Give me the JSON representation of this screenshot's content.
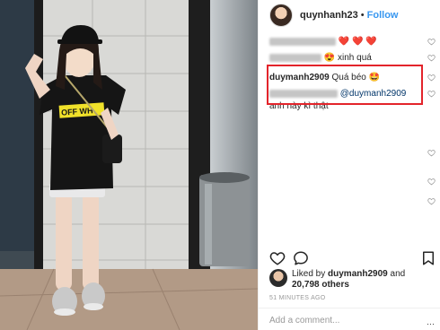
{
  "header": {
    "username": "quynhanh23",
    "separator": "•",
    "follow_label": "Follow"
  },
  "comments": [
    {
      "user_hidden": true,
      "text": "❤️ ❤️ ❤️"
    },
    {
      "user_hidden": true,
      "emoji": "😍",
      "text": "xinh quá"
    },
    {
      "user": "duymanh2909",
      "text": "Quá béo 🤩"
    },
    {
      "user_hidden": true,
      "mention": "@duymanh2909",
      "text": "anh này kì thật"
    }
  ],
  "likes": {
    "prefix": "Liked by",
    "user": "duymanh2909",
    "joiner": "and",
    "count": "20,798 others"
  },
  "timestamp": "51 MINUTES AGO",
  "add_comment_placeholder": "Add a comment...",
  "more_icon": "···",
  "colors": {
    "link_blue": "#3897f0",
    "highlight_red": "#e3242b",
    "text_dark": "#262626",
    "muted": "#999999"
  },
  "icons": [
    "heart-icon",
    "comment-icon",
    "bookmark-icon",
    "more-options-icon"
  ]
}
